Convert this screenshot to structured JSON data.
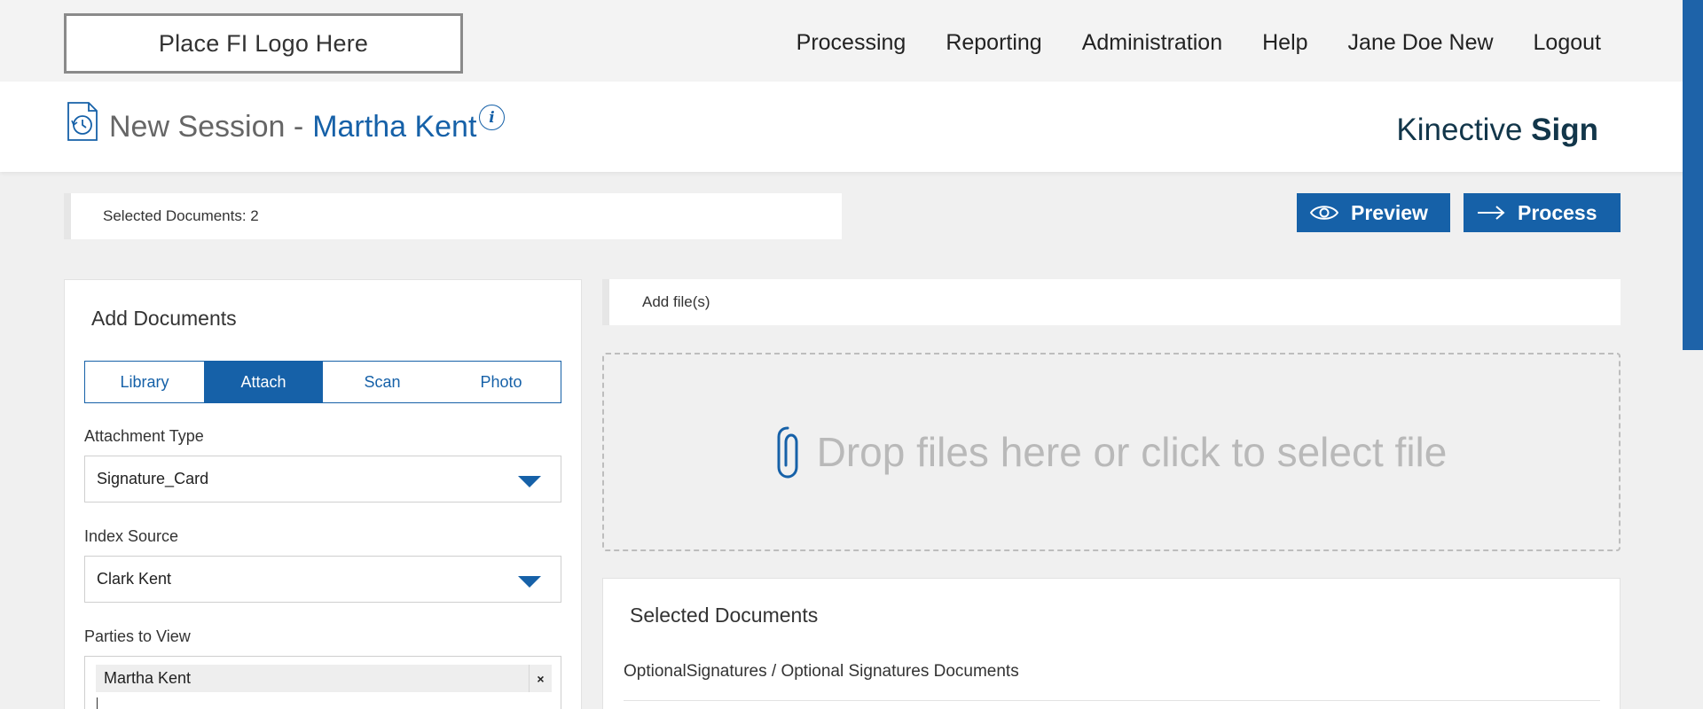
{
  "header": {
    "logo_text": "Place FI Logo Here",
    "nav": [
      "Processing",
      "Reporting",
      "Administration",
      "Help",
      "Jane Doe New",
      "Logout"
    ]
  },
  "session": {
    "title_prefix": "New Session -",
    "customer_name": "Martha Kent",
    "info_glyph": "i",
    "brand_regular": "Kinective",
    "brand_bold": "Sign"
  },
  "selected_bar": {
    "text": "Selected Documents: 2"
  },
  "actions": {
    "preview_label": "Preview",
    "process_label": "Process"
  },
  "add_documents": {
    "title": "Add Documents",
    "tabs": [
      "Library",
      "Attach",
      "Scan",
      "Photo"
    ],
    "active_tab": "Attach",
    "attachment_type": {
      "label": "Attachment Type",
      "value": "Signature_Card"
    },
    "index_source": {
      "label": "Index Source",
      "value": "Clark Kent"
    },
    "parties": {
      "label": "Parties to View",
      "chips": [
        "Martha Kent"
      ],
      "remove_glyph": "×"
    }
  },
  "add_files": {
    "text": "Add file(s)"
  },
  "dropzone": {
    "text": "Drop files here or click to select file"
  },
  "selected_documents": {
    "title": "Selected Documents",
    "group": "OptionalSignatures / Optional Signatures Documents"
  },
  "colors": {
    "accent": "#1661a8",
    "brand": "#12364a",
    "background": "#f0f0f0"
  },
  "icons": {
    "session": "history-document-icon",
    "info": "info-icon",
    "preview": "eye-icon",
    "process": "arrow-right-icon",
    "drop": "paperclip-icon",
    "chip_remove": "close-icon"
  }
}
